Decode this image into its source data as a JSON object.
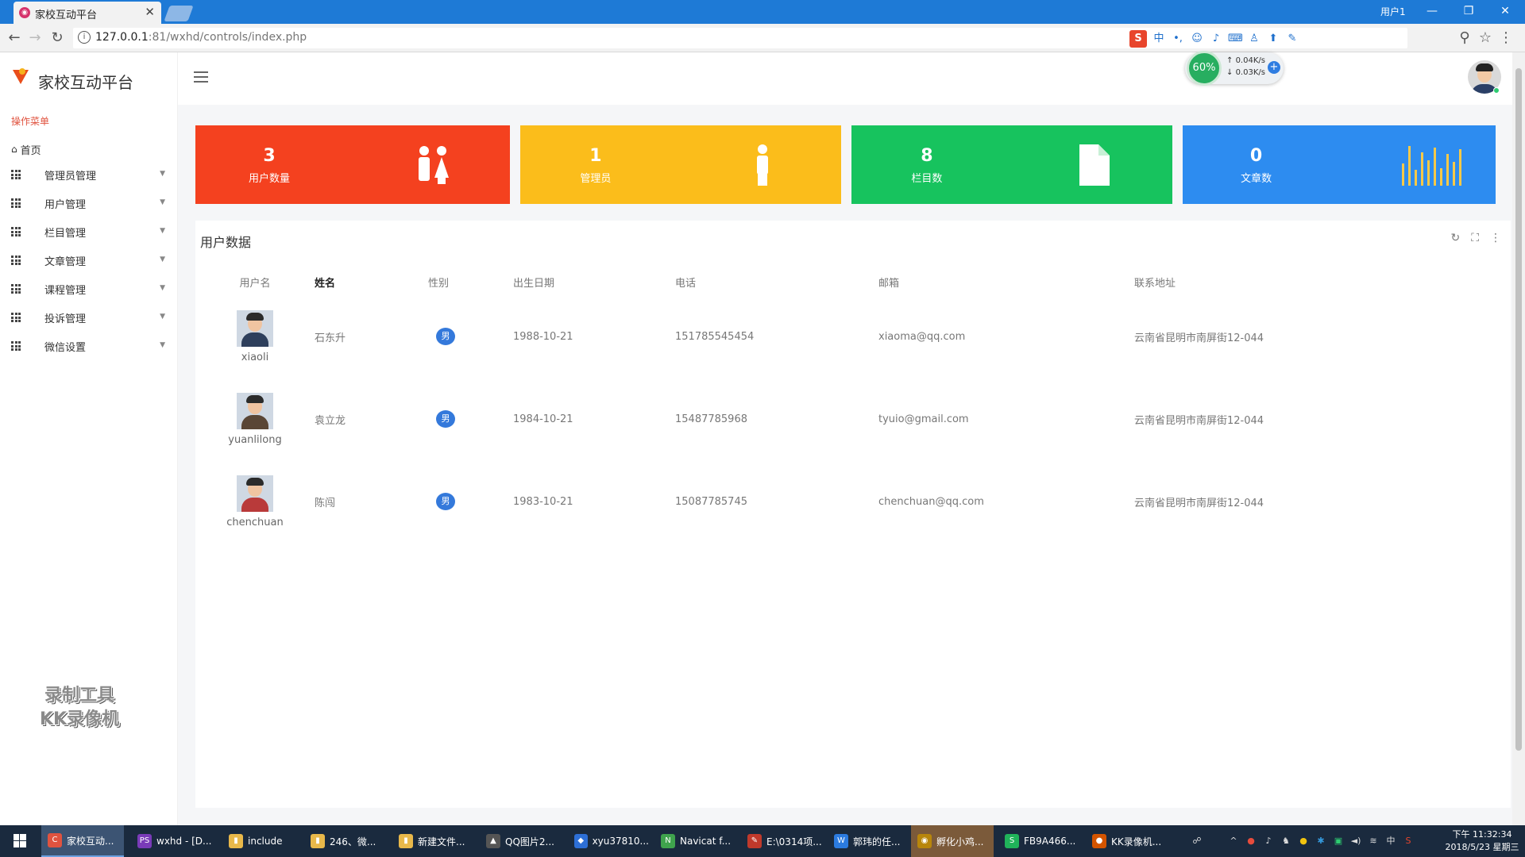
{
  "browser": {
    "tab_title": "家校互动平台",
    "tab_close": "✕",
    "window_user": "用户1",
    "url_host": "127.0.0.1",
    "url_rest": ":81/wxhd/controls/index.php",
    "window_controls": [
      "—",
      "❐",
      "✕"
    ]
  },
  "app": {
    "title": "家校互动平台",
    "menu_label": "操作菜单",
    "home_label": "首页",
    "menu_items": [
      "管理员管理",
      "用户管理",
      "栏目管理",
      "文章管理",
      "课程管理",
      "投诉管理",
      "微信设置"
    ]
  },
  "header": {
    "net_percent": "60%",
    "net_up": "0.04K/s",
    "net_down": "0.03K/s",
    "net_plus": "+"
  },
  "stats": [
    {
      "value": "3",
      "label": "用户数量",
      "color": "#f4411f",
      "icon": "users-icon"
    },
    {
      "value": "1",
      "label": "管理员",
      "color": "#fbbd1b",
      "icon": "person-icon"
    },
    {
      "value": "8",
      "label": "栏目数",
      "color": "#17c35e",
      "icon": "document-icon"
    },
    {
      "value": "0",
      "label": "文章数",
      "color": "#2d8cf0",
      "icon": "bar-chart-icon"
    }
  ],
  "table": {
    "title": "用户数据",
    "columns": [
      "用户名",
      "姓名",
      "性别",
      "出生日期",
      "电话",
      "邮箱",
      "联系地址"
    ],
    "rows": [
      {
        "username": "xiaoli",
        "name": "石东升",
        "gender": "男",
        "birth": "1988-10-21",
        "phone": "151785545454",
        "email": "xiaoma@qq.com",
        "address": "云南省昆明市南屏街12-044"
      },
      {
        "username": "yuanlilong",
        "name": "袁立龙",
        "gender": "男",
        "birth": "1984-10-21",
        "phone": "15487785968",
        "email": "tyuio@gmail.com",
        "address": "云南省昆明市南屏街12-044"
      },
      {
        "username": "chenchuan",
        "name": "陈闯",
        "gender": "男",
        "birth": "1983-10-21",
        "phone": "15087785745",
        "email": "chenchuan@qq.com",
        "address": "云南省昆明市南屏街12-044"
      }
    ]
  },
  "watermark": [
    "录制工具",
    "KK录像机"
  ],
  "taskbar": {
    "items": [
      {
        "label": "家校互动...",
        "color": "#e0533f",
        "glyph": "C"
      },
      {
        "label": "wxhd - [D...",
        "color": "#7a3bb8",
        "glyph": "PS"
      },
      {
        "label": "include",
        "color": "#e8b84a",
        "glyph": "▮"
      },
      {
        "label": "246、微...",
        "color": "#e8b84a",
        "glyph": "▮"
      },
      {
        "label": "新建文件...",
        "color": "#e8b84a",
        "glyph": "▮"
      },
      {
        "label": "QQ图片2...",
        "color": "#555555",
        "glyph": "▲"
      },
      {
        "label": "xyu37810...",
        "color": "#2d6fd6",
        "glyph": "◆"
      },
      {
        "label": "Navicat f...",
        "color": "#3fa34d",
        "glyph": "N"
      },
      {
        "label": "E:\\0314项...",
        "color": "#c0392b",
        "glyph": "✎"
      },
      {
        "label": "郭玮的任...",
        "color": "#2b7be0",
        "glyph": "W"
      },
      {
        "label": "孵化小鸡...",
        "color": "#b8860b",
        "glyph": "◉"
      },
      {
        "label": "FB9A466...",
        "color": "#20b35a",
        "glyph": "S"
      },
      {
        "label": "KK录像机...",
        "color": "#d35400",
        "glyph": "●"
      }
    ],
    "clock_time": "下午 11:32:34",
    "clock_date": "2018/5/23 星期三",
    "ime": "中"
  }
}
